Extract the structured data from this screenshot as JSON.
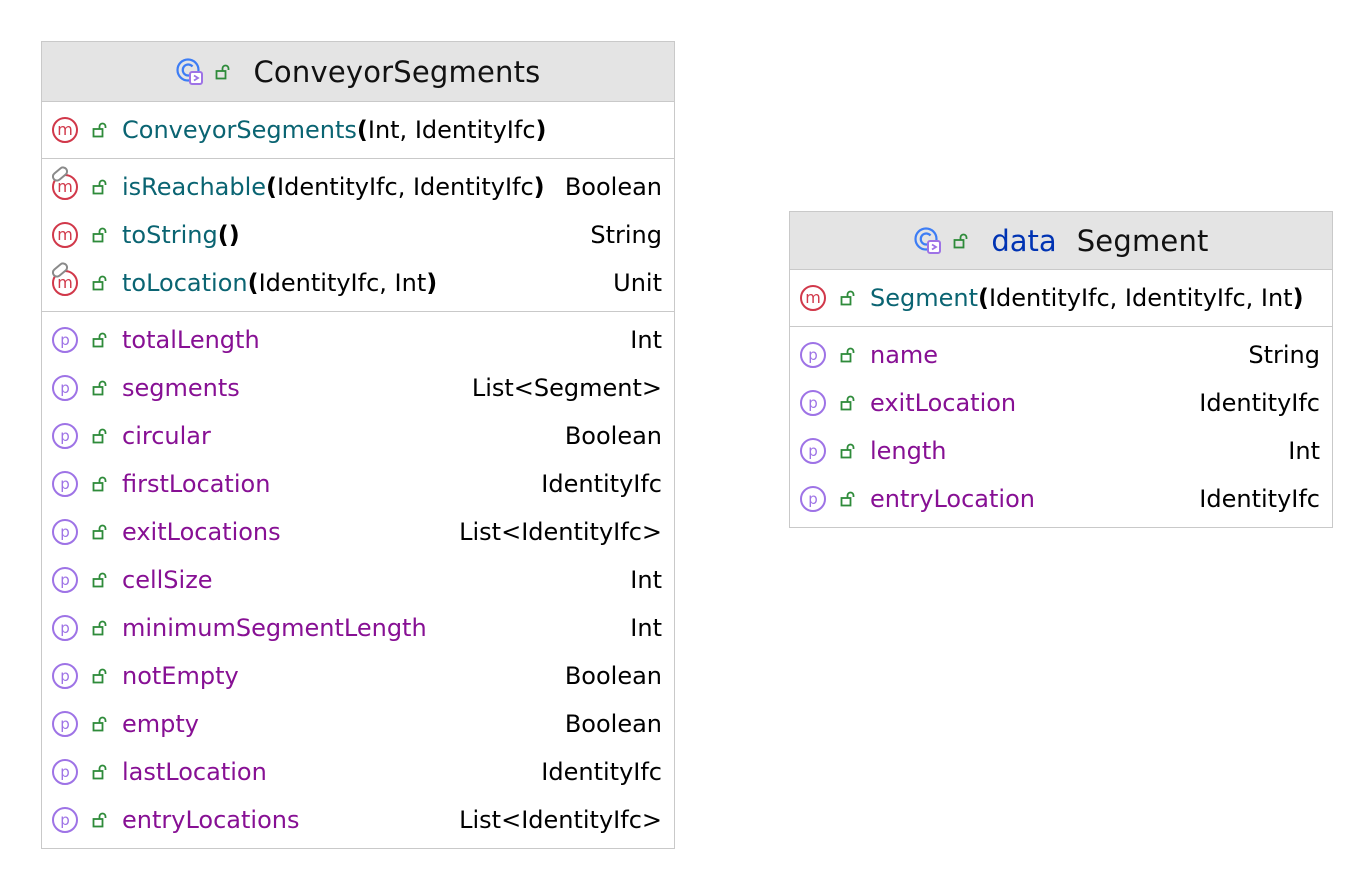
{
  "classes": [
    {
      "title": "ConveyorSegments",
      "keyword": "",
      "constructors": [
        {
          "name": "ConveyorSegments",
          "params": "Int, IdentityIfc"
        }
      ],
      "methods": [
        {
          "name": "isReachable",
          "params": "IdentityIfc, IdentityIfc",
          "type": "Boolean",
          "override": true
        },
        {
          "name": "toString",
          "params": "",
          "type": "String",
          "override": false
        },
        {
          "name": "toLocation",
          "params": "IdentityIfc, Int",
          "type": "Unit",
          "override": true
        }
      ],
      "properties": [
        {
          "name": "totalLength",
          "type": "Int"
        },
        {
          "name": "segments",
          "type": "List<Segment>"
        },
        {
          "name": "circular",
          "type": "Boolean"
        },
        {
          "name": "firstLocation",
          "type": "IdentityIfc"
        },
        {
          "name": "exitLocations",
          "type": "List<IdentityIfc>"
        },
        {
          "name": "cellSize",
          "type": "Int"
        },
        {
          "name": "minimumSegmentLength",
          "type": "Int"
        },
        {
          "name": "notEmpty",
          "type": "Boolean"
        },
        {
          "name": "empty",
          "type": "Boolean"
        },
        {
          "name": "lastLocation",
          "type": "IdentityIfc"
        },
        {
          "name": "entryLocations",
          "type": "List<IdentityIfc>"
        }
      ]
    },
    {
      "title": "Segment",
      "keyword": "data",
      "constructors": [
        {
          "name": "Segment",
          "params": "IdentityIfc, IdentityIfc, Int"
        }
      ],
      "methods": [],
      "properties": [
        {
          "name": "name",
          "type": "String"
        },
        {
          "name": "exitLocation",
          "type": "IdentityIfc"
        },
        {
          "name": "length",
          "type": "Int"
        },
        {
          "name": "entryLocation",
          "type": "IdentityIfc"
        }
      ]
    }
  ],
  "icons": {
    "class": "class-icon",
    "visibility": "public-lock-icon",
    "method_letter": "m",
    "property_letter": "p",
    "override": "override-icon"
  },
  "colors": {
    "method_name": "#0a6472",
    "property_name": "#871094",
    "keyword": "#0033b3",
    "method_icon": "#d1384a",
    "property_icon": "#9e73e6",
    "lock": "#2e8b3a",
    "header_bg": "#e4e4e4"
  }
}
